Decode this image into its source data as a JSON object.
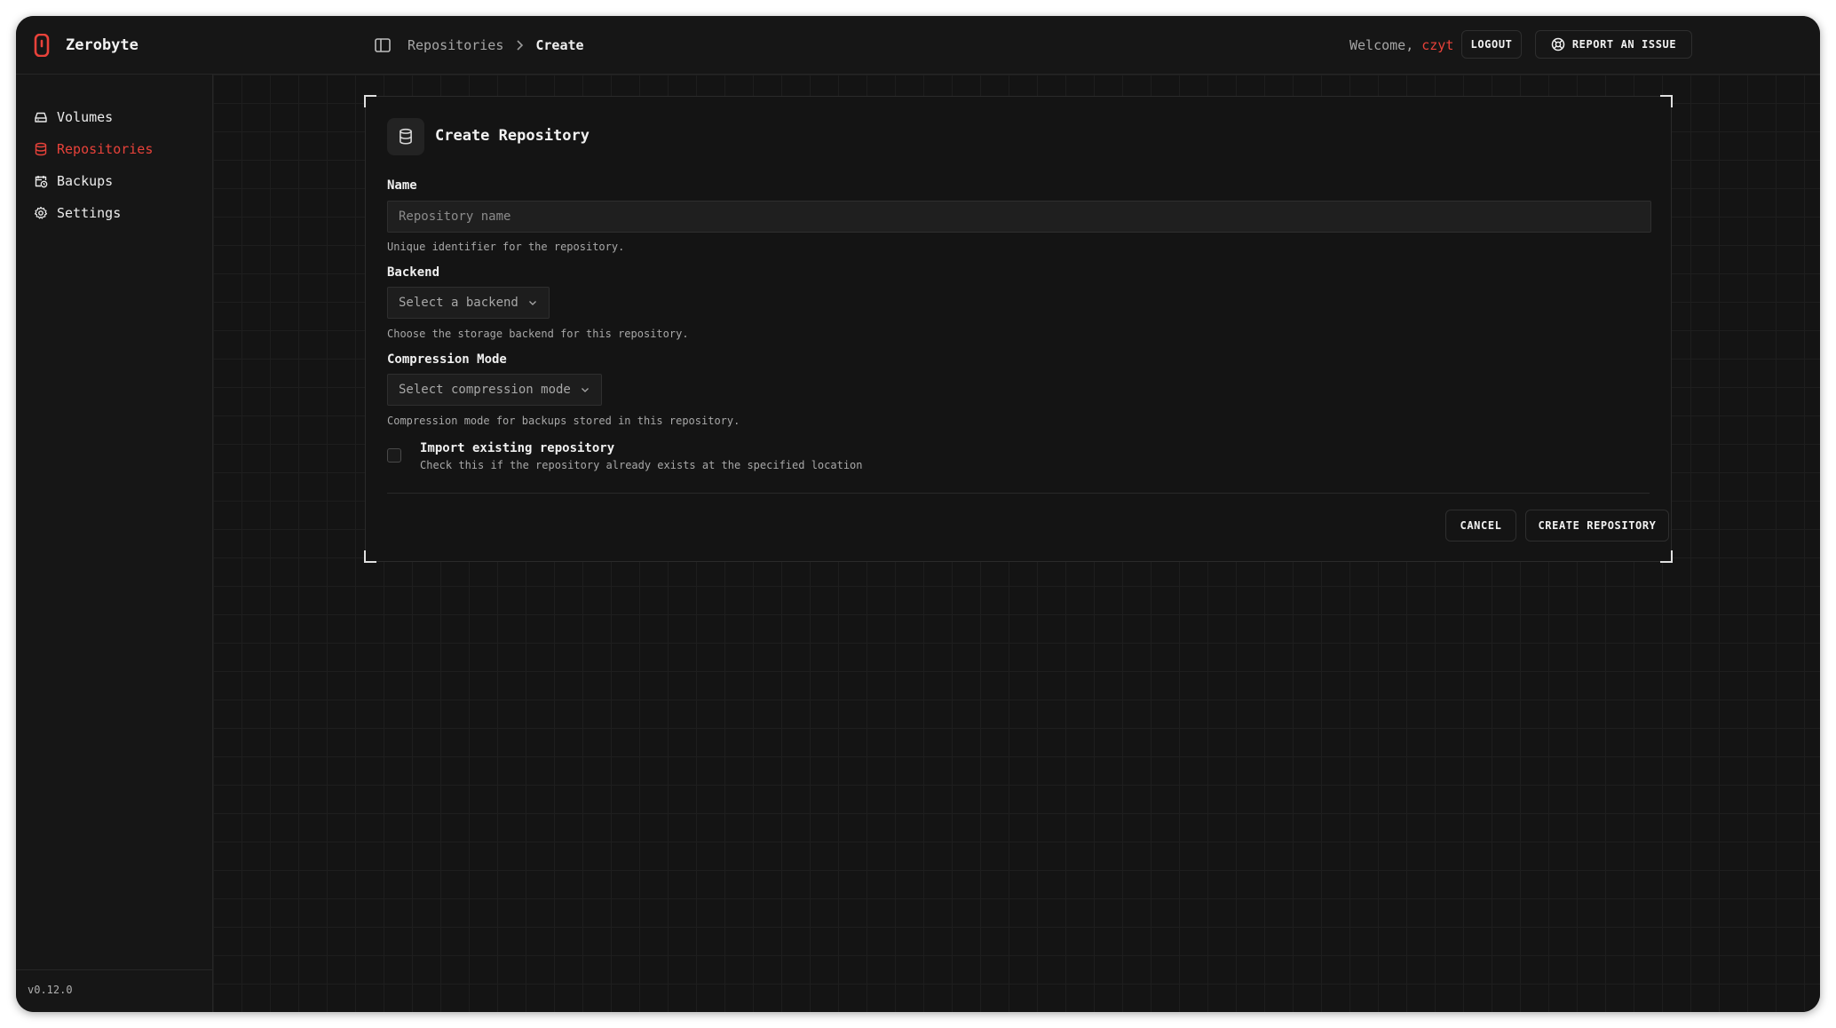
{
  "app": {
    "name": "Zerobyte",
    "accent_color": "#e8423a",
    "version": "v0.12.0"
  },
  "breadcrumb": {
    "parent": "Repositories",
    "current": "Create"
  },
  "header": {
    "welcome_text": "Welcome,",
    "username": "czyt",
    "logout_label": "LOGOUT",
    "report_label": "REPORT AN ISSUE"
  },
  "sidebar": {
    "items": [
      {
        "label": "Volumes",
        "icon": "hard-drive-icon",
        "active": false
      },
      {
        "label": "Repositories",
        "icon": "database-icon",
        "active": true
      },
      {
        "label": "Backups",
        "icon": "calendar-clock-icon",
        "active": false
      },
      {
        "label": "Settings",
        "icon": "gear-icon",
        "active": false
      }
    ]
  },
  "form": {
    "title": "Create Repository",
    "title_icon": "database-icon",
    "name": {
      "label": "Name",
      "value": "",
      "placeholder": "Repository name",
      "helper": "Unique identifier for the repository."
    },
    "backend": {
      "label": "Backend",
      "value": "Select a backend",
      "helper": "Choose the storage backend for this repository."
    },
    "compression": {
      "label": "Compression Mode",
      "value": "Select compression mode",
      "helper": "Compression mode for backups stored in this repository."
    },
    "import_existing": {
      "label": "Import existing repository",
      "description": "Check this if the repository already exists at the specified location",
      "checked": false
    },
    "cancel_label": "CANCEL",
    "submit_label": "CREATE REPOSITORY"
  }
}
